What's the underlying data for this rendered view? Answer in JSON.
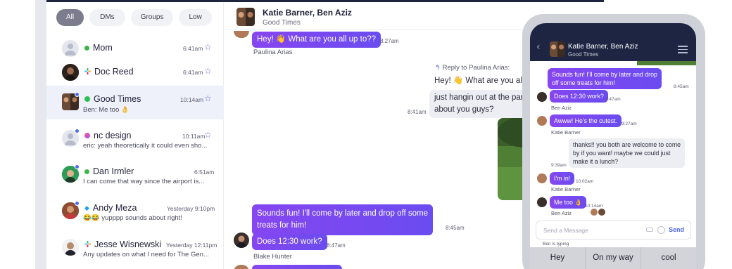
{
  "sidebar": {
    "filters": [
      "All",
      "DMs",
      "Groups",
      "Low"
    ],
    "conversations": [
      {
        "name": "Mom",
        "time": "6:41am",
        "preview": ""
      },
      {
        "name": "Doc Reed",
        "time": "6:41am",
        "preview": ""
      },
      {
        "name": "Good Times",
        "time": "10:14am",
        "preview": "Ben: Me too 👌"
      },
      {
        "name": "nc design",
        "time": "10:11am",
        "preview": "eric: yeah theoretically it could even sho..."
      },
      {
        "name": "Dan Irmler",
        "time": "6:51am",
        "preview": "I can come that way since the airport is..."
      },
      {
        "name": "Andy Meza",
        "time": "Yesterday 9:10pm",
        "preview": "😂😂 yupppp sounds about right!"
      },
      {
        "name": "Jesse Wisnewski",
        "time": "Yesterday 12:11pm",
        "preview": "Any updates on what I need for The Gen..."
      }
    ]
  },
  "chat": {
    "title": "Katie Barner, Ben Aziz",
    "subtitle": "Good Times",
    "messages": {
      "m1": {
        "text": "Hey! 👋 What are you all up to??",
        "time": "8:27am",
        "sender": "Paulina Arias"
      },
      "reply_to": "Reply to Paulina Arias:",
      "reply_quote": "Hey! 👋 What are you all up to??",
      "m2_line1": "just hangin out at the park with my dog",
      "m2_line2": "about you guys?",
      "m2_time": "8:41am",
      "m3_line1": "Sounds fun! I'll come by later and drop off some",
      "m3_line2": "treats for him!",
      "m3_time": "8:45am",
      "m4": {
        "text": "Does 12:30 work?",
        "time": "8:47am",
        "sender": "Blake Hunter"
      }
    }
  },
  "phone": {
    "title": "Katie Barner, Ben Aziz",
    "subtitle": "Good Times",
    "messages": {
      "p1_line1": "Sounds fun! I'll come by later and drop",
      "p1_line2": "off some treats for him!",
      "p1_time": "8:45am",
      "p2": {
        "text": "Does 12:30 work?",
        "time": "8:47am",
        "sender": "Ben Aziz"
      },
      "p3": {
        "text": "Awww! He's the cutest.",
        "time": "9:27am",
        "sender": "Katie Barner"
      },
      "p4_line1": "thanks!! you both are welcome to come",
      "p4_line2": "by if you want! maybe we could just",
      "p4_line3": "make it a lunch?",
      "p4_time": "9:39am",
      "p5": {
        "text": "I'm in!",
        "time": "10:02am",
        "sender": "Katie Barner"
      },
      "p6": {
        "text": "Me too 👌",
        "time": "10:14am",
        "sender": "Ben Aziz"
      }
    },
    "input_placeholder": "Send a Message",
    "send_label": "Send",
    "typing": "Ben is typing",
    "suggestions": [
      "Hey",
      "On my way",
      "cool"
    ]
  },
  "colors": {
    "accent": "#6a4cf0",
    "unread_dot": "#4f6df0",
    "header_dark": "#1d2542"
  }
}
